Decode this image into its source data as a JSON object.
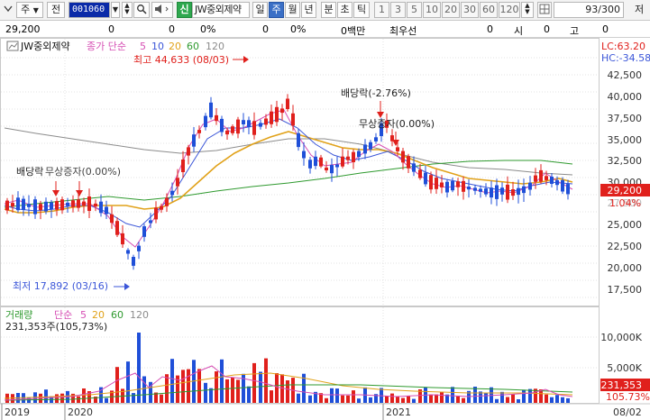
{
  "toolbar": {
    "period_selector": "주",
    "prev_label": "전",
    "stock_code": "001060",
    "stock_name": "JW중외제약",
    "badge_sin": "신",
    "period_tabs": [
      "일",
      "주",
      "월",
      "년",
      "분",
      "초",
      "틱"
    ],
    "active_period": "주",
    "interval_buttons": [
      "1",
      "3",
      "5",
      "10",
      "20",
      "30",
      "60",
      "120"
    ],
    "page_count": "93/300",
    "right_label": "저"
  },
  "status_row": {
    "price": "29,200",
    "field1": "0",
    "field2": "0",
    "field3": "0%",
    "field4": "0",
    "field5": "0%",
    "field6": "0백만",
    "field7": "최우선",
    "field8": "0",
    "field9": "시",
    "field10": "0",
    "field11": "고",
    "field12": "0"
  },
  "price_panel": {
    "legend_stock": "JW중외제약",
    "legend_ma_label": "종가 단순",
    "legend_ma_periods": [
      "5",
      "10",
      "20",
      "60",
      "120"
    ],
    "high_annotation": "최고 44,633 (08/03)",
    "low_annotation": "최저 17,892 (03/16)",
    "dividend_annotation_1": "배당락(-2.76%)",
    "bonus_annotation_1": "무상증자(0.00%)",
    "dividend_annotation_2": "배당락",
    "bonus_annotation_2": "무상증자(0.00%)",
    "lc_label": "LC:63.20",
    "hc_label": "HC:-34.58",
    "current_price_tag": "29,200",
    "current_change_tag": "1.04%",
    "y_axis_ticks": [
      "42,500",
      "40,000",
      "37,500",
      "35,000",
      "32,500",
      "30,000",
      "27,500",
      "25,000",
      "22,500",
      "20,000",
      "17,500"
    ]
  },
  "volume_panel": {
    "legend_label": "거래량",
    "legend_ma_label": "단순",
    "legend_ma_periods": [
      "5",
      "20",
      "60",
      "120"
    ],
    "current_volume": "231,353주(105,73%)",
    "current_volume_tag": "231,353",
    "current_ratio_tag": "105.73%",
    "y_axis_ticks": [
      "10,000K",
      "5,000K",
      "0K"
    ]
  },
  "x_axis": {
    "labels": [
      "2019",
      "2020",
      "2021",
      "08/02"
    ]
  },
  "colors": {
    "up": "#e0201c",
    "down": "#1f4fd8",
    "ma5": "#d64fb4",
    "ma10": "#3b56d8",
    "ma20": "#e1a21a",
    "ma60": "#2f9a2f",
    "ma120": "#8c8c8c",
    "accent_blue": "#0a2aa8"
  }
}
